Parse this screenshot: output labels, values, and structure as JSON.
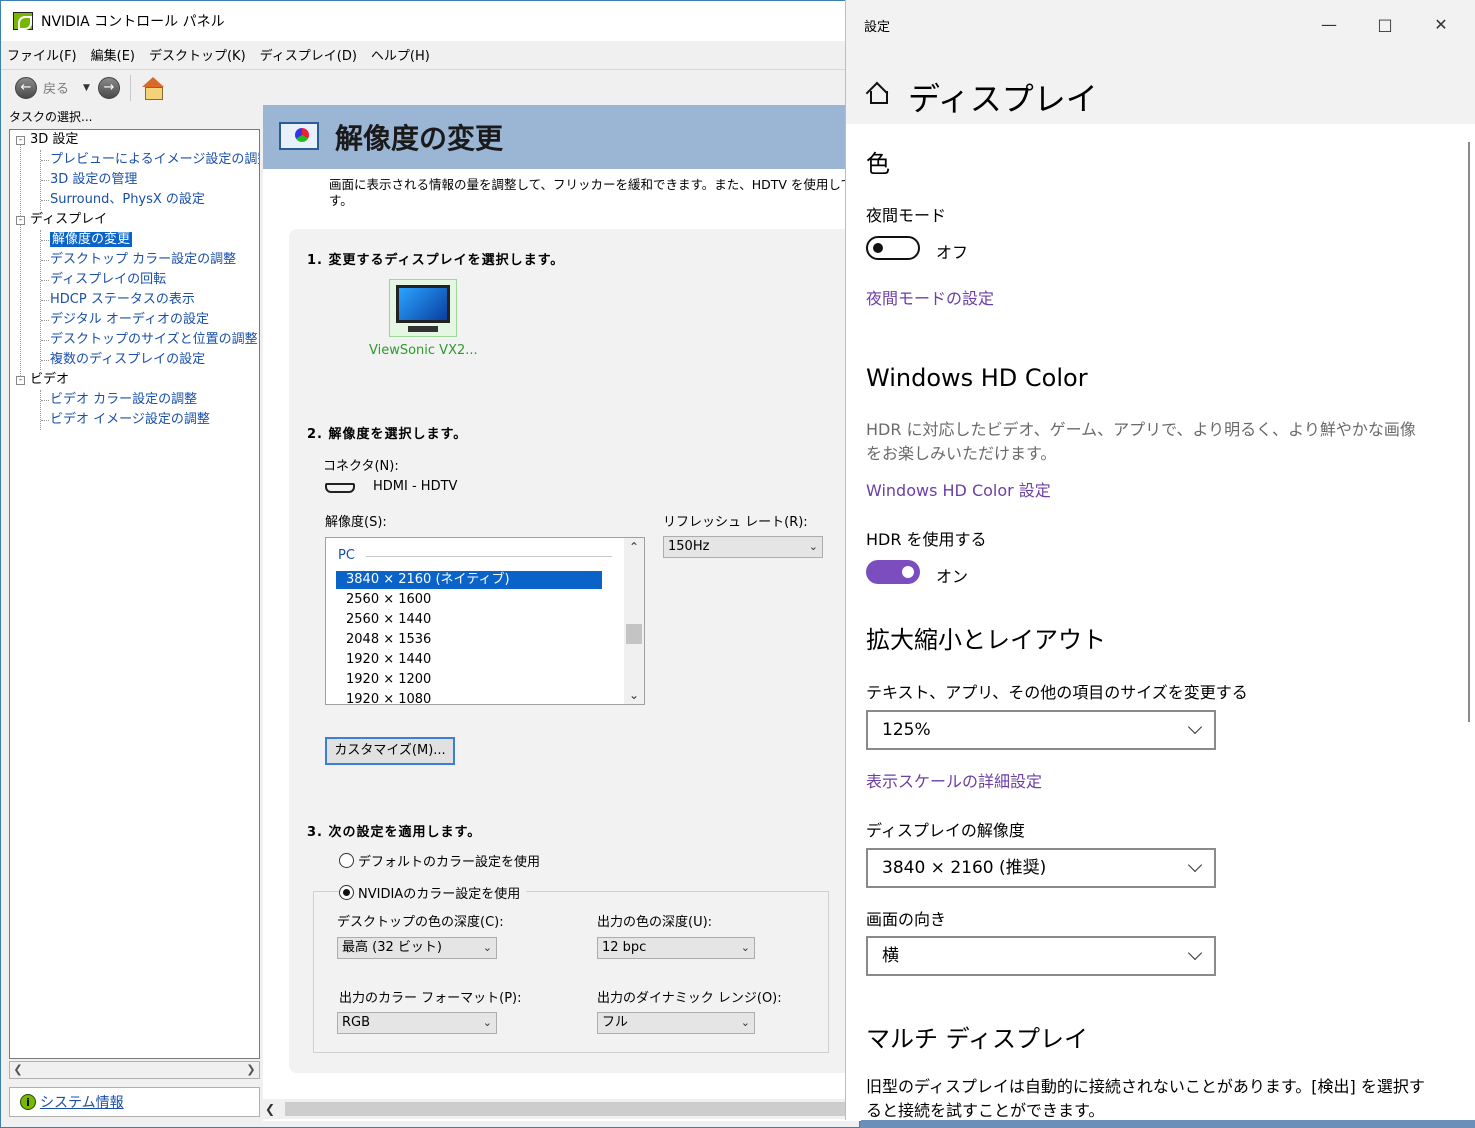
{
  "nvidia": {
    "title": "NVIDIA コントロール パネル",
    "menu": [
      "ファイル(F)",
      "編集(E)",
      "デスクトップ(K)",
      "ディスプレイ(D)",
      "ヘルプ(H)"
    ],
    "toolbar": {
      "back_label": "戻る"
    },
    "task_label": "タスクの選択...",
    "tree": {
      "cat_3d": "3D 設定",
      "item_preview": "プレビューによるイメージ設定の調整",
      "item_3d_manage": "3D 設定の管理",
      "item_surround": "Surround、PhysX の設定",
      "cat_display": "ディスプレイ",
      "item_resolution": "解像度の変更",
      "item_desktop_color": "デスクトップ カラー設定の調整",
      "item_rotate": "ディスプレイの回転",
      "item_hdcp": "HDCP ステータスの表示",
      "item_audio": "デジタル オーディオの設定",
      "item_size_pos": "デスクトップのサイズと位置の調整",
      "item_multi": "複数のディスプレイの設定",
      "cat_video": "ビデオ",
      "item_video_color": "ビデオ カラー設定の調整",
      "item_video_image": "ビデオ イメージ設定の調整"
    },
    "sysinfo": "システム情報",
    "page_title": "解像度の変更",
    "description": "画面に表示される情報の量を調整して、フリッカーを緩和できます。また、HDTV を使用して",
    "description_2": "す。",
    "step1": "1. 変更するディスプレイを選択します。",
    "display_name": "ViewSonic VX2...",
    "step2": "2. 解像度を選択します。",
    "connector_label": "コネクタ(N):",
    "connector_value": "HDMI - HDTV",
    "resolution_label": "解像度(S):",
    "refresh_label": "リフレッシュ レート(R):",
    "refresh_value": "150Hz",
    "res_group": "PC",
    "resolutions": [
      "3840 × 2160 (ネイティブ)",
      "2560 × 1600",
      "2560 × 1440",
      "2048 × 1536",
      "1920 × 1440",
      "1920 × 1200",
      "1920 × 1080"
    ],
    "customize": "カスタマイズ(M)...",
    "step3": "3. 次の設定を適用します。",
    "radio_default": "デフォルトのカラー設定を使用",
    "radio_nvidia": "NVIDIAのカラー設定を使用",
    "depth_label": "デスクトップの色の深度(C):",
    "depth_value": "最高 (32 ビット)",
    "out_depth_label": "出力の色の深度(U):",
    "out_depth_value": "12 bpc",
    "format_label": "出力のカラー フォーマット(P):",
    "format_value": "RGB",
    "range_label": "出力のダイナミック レンジ(O):",
    "range_value": "フル"
  },
  "settings": {
    "title": "設定",
    "page_title": "ディスプレイ",
    "color_heading": "色",
    "night_label": "夜間モード",
    "night_state": "オフ",
    "night_link": "夜間モードの設定",
    "hd_heading": "Windows HD Color",
    "hd_desc": "HDR に対応したビデオ、ゲーム、アプリで、より明るく、より鮮やかな画像をお楽しみいただけます。",
    "hd_link": "Windows HD Color 設定",
    "hdr_label": "HDR を使用する",
    "hdr_state": "オン",
    "scale_heading": "拡大縮小とレイアウト",
    "scale_label": "テキスト、アプリ、その他の項目のサイズを変更する",
    "scale_value": "125%",
    "scale_link": "表示スケールの詳細設定",
    "res_label": "ディスプレイの解像度",
    "res_value": "3840 × 2160 (推奨)",
    "orient_label": "画面の向き",
    "orient_value": "横",
    "multi_heading": "マルチ ディスプレイ",
    "multi_desc": "旧型のディスプレイは自動的に接続されないことがあります。[検出] を選択すると接続を試すことができます。"
  }
}
